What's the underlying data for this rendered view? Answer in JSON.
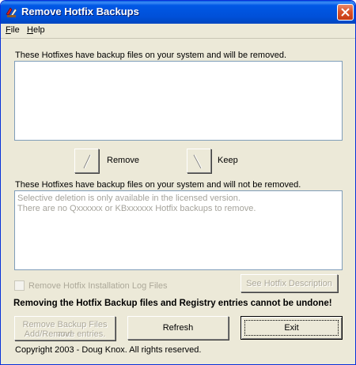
{
  "window": {
    "title": "Remove Hotfix Backups"
  },
  "menu": {
    "file": "File",
    "file_key": "F",
    "file_rest": "ile",
    "help_key": "H",
    "help_rest": "elp"
  },
  "top_section": {
    "label": "These Hotfixes have backup files on your system and will be removed."
  },
  "move": {
    "remove_label": "Remove",
    "keep_label": "Keep"
  },
  "bottom_section": {
    "label": "These Hotfixes have backup files on your system and will not be removed.",
    "lines": [
      "Selective deletion is only available in the licensed version.",
      "There are no Qxxxxxx or KBxxxxxx Hotfix backups to remove."
    ]
  },
  "options": {
    "log_checkbox_label": "Remove Hotfix Installation Log Files",
    "log_checkbox_checked": false,
    "see_description_label": "See Hotfix Description"
  },
  "warning": "Removing the Hotfix Backup files and Registry entries cannot be undone!",
  "buttons": {
    "remove_backup_line1": "Remove Backup Files and",
    "remove_backup_line2": "Add/Remove  entries.",
    "refresh": "Refresh",
    "exit": "Exit"
  },
  "footer": {
    "copyright": "Copyright 2003 - Doug Knox. All rights reserved."
  },
  "colors": {
    "title_bar": "#0054e3",
    "close_button": "#d9542b",
    "dialog_bg": "#ece9d8",
    "list_border": "#7f9db9"
  }
}
